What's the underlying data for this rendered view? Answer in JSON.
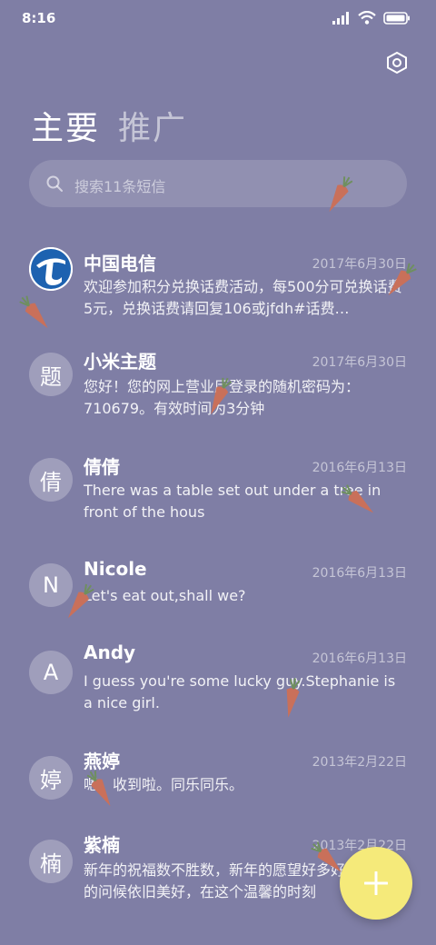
{
  "status_bar": {
    "time": "8:16"
  },
  "tabs": [
    {
      "label": "主要",
      "active": true
    },
    {
      "label": "推广",
      "active": false
    }
  ],
  "search": {
    "placeholder": "搜索11条短信"
  },
  "messages": [
    {
      "avatar": "",
      "avatar_type": "china-telecom-logo",
      "sender": "中国电信",
      "date": "2017年6月30日",
      "preview": "欢迎参加积分兑换话费活动，每500分可兑换话费5元，兑换话费请回复106或jfdh#话费…"
    },
    {
      "avatar": "题",
      "sender": "小米主题",
      "date": "2017年6月30日",
      "preview": "您好！您的网上营业厅登录的随机密码为：710679。有效时间为3分钟"
    },
    {
      "avatar": "倩",
      "sender": "倩倩",
      "date": "2016年6月13日",
      "preview": "There was a table set out under a tree in front of the hous"
    },
    {
      "avatar": "N",
      "sender": "Nicole",
      "date": "2016年6月13日",
      "preview": "Let's eat out,shall we?"
    },
    {
      "avatar": "A",
      "sender": "Andy",
      "date": "2016年6月13日",
      "preview": "I guess you're some lucky guy.Stephanie is a nice girl."
    },
    {
      "avatar": "婷",
      "sender": "燕婷",
      "date": "2013年2月22日",
      "preview": "嗯。收到啦。同乐同乐。"
    },
    {
      "avatar": "楠",
      "sender": "紫楠",
      "date": "2013年2月22日",
      "preview": "新年的祝福数不胜数，新年的愿望好多好多，新年的问候依旧美好，在这个温馨的时刻"
    }
  ],
  "colors": {
    "background": "#7f7ea5",
    "fab": "#f5ea7a",
    "carrot": "#c9705a",
    "leaf": "#6f8f5f"
  }
}
